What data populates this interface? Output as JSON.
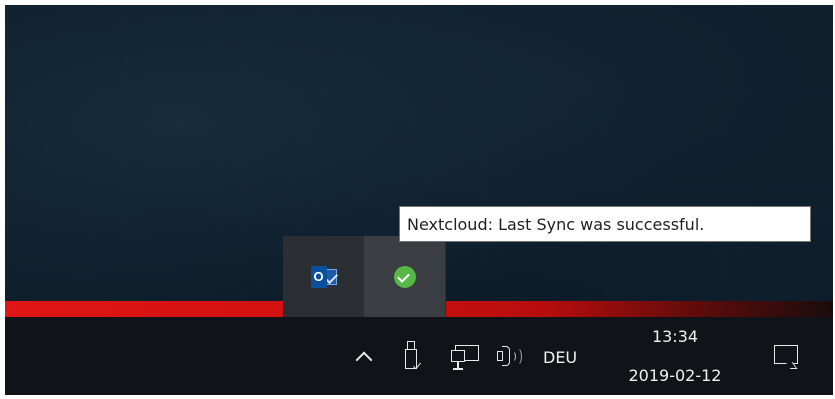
{
  "tooltip": {
    "text": "Nextcloud: Last Sync was successful."
  },
  "tray_overflow": {
    "items": [
      {
        "name": "Microsoft Outlook",
        "icon": "outlook-icon",
        "glyph": "O"
      },
      {
        "name": "Nextcloud",
        "icon": "check-circle-icon",
        "color": "#56b947"
      }
    ]
  },
  "taskbar": {
    "show_hidden_icons": "chevron-up-icon",
    "icons": [
      "usb-icon",
      "network-icon",
      "volume-icon"
    ],
    "language": "DEU",
    "clock": {
      "time": "13:34",
      "date": "2019-02-12"
    },
    "action_center": "action-center-icon"
  },
  "colors": {
    "taskbar": "#101419",
    "popup": "#2b2f33",
    "accent_red": "#e01515",
    "nextcloud_green": "#56b947",
    "outlook_blue": "#0a4f9c"
  }
}
